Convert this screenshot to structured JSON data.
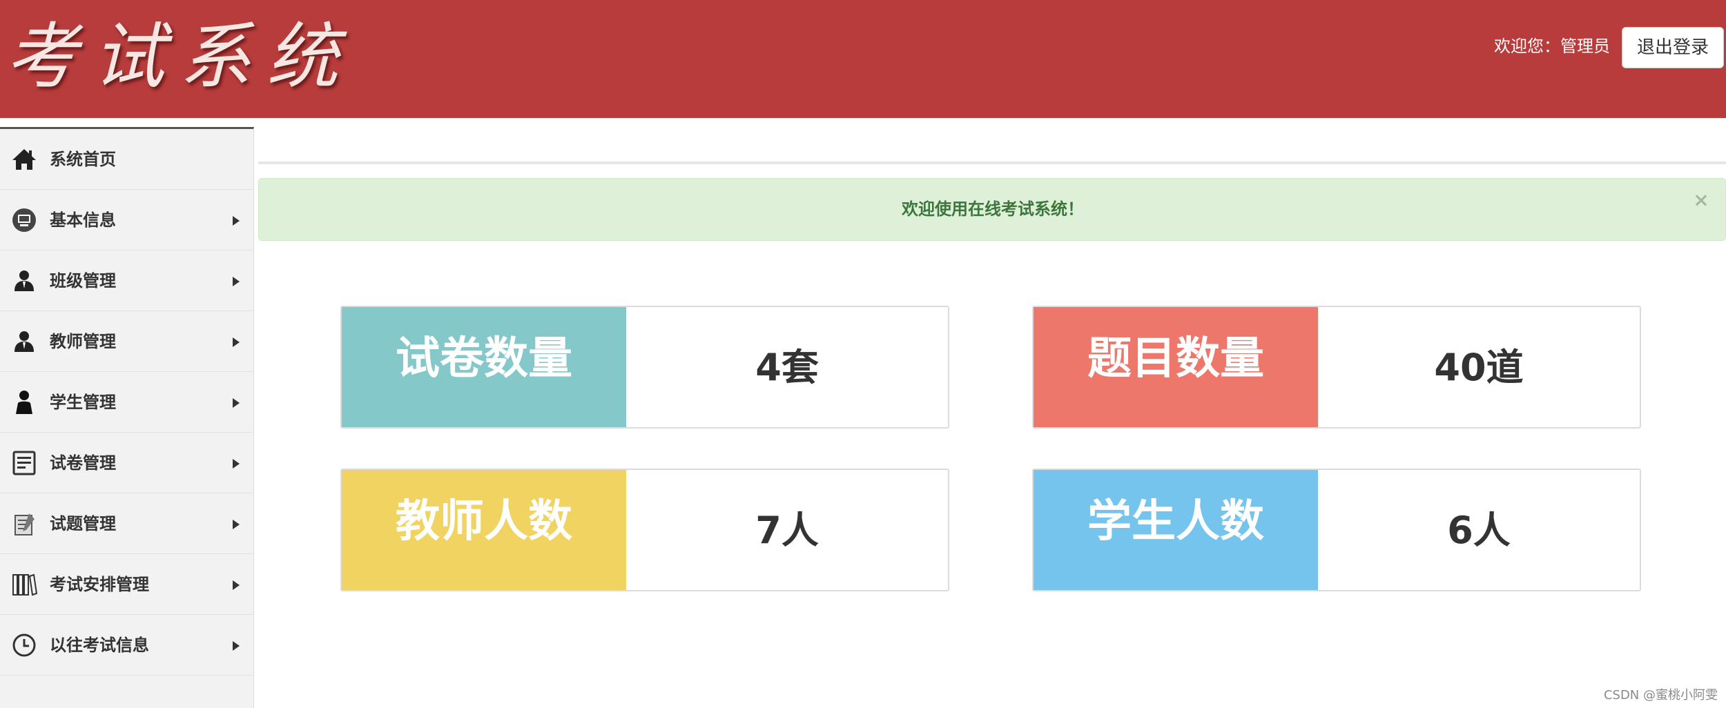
{
  "header": {
    "logo_text": "考试系统",
    "welcome_text": "欢迎您：管理员",
    "logout_label": "退出登录",
    "background_color": "#b73c3b"
  },
  "sidebar": {
    "items": [
      {
        "label": "系统首页",
        "icon": "home-icon",
        "has_submenu": false
      },
      {
        "label": "基本信息",
        "icon": "monitor-icon",
        "has_submenu": true
      },
      {
        "label": "班级管理",
        "icon": "user-icon",
        "has_submenu": true
      },
      {
        "label": "教师管理",
        "icon": "user-icon",
        "has_submenu": true
      },
      {
        "label": "学生管理",
        "icon": "user-icon",
        "has_submenu": true
      },
      {
        "label": "试卷管理",
        "icon": "document-icon",
        "has_submenu": true
      },
      {
        "label": "试题管理",
        "icon": "notepad-icon",
        "has_submenu": true
      },
      {
        "label": "考试安排管理",
        "icon": "books-icon",
        "has_submenu": true
      },
      {
        "label": "以往考试信息",
        "icon": "clock-icon",
        "has_submenu": true
      }
    ]
  },
  "alert": {
    "message": "欢迎使用在线考试系统！",
    "close_symbol": "×",
    "background_color": "#dff0d8",
    "text_color": "#3c763d"
  },
  "stats": [
    {
      "label": "试卷数量",
      "value": "4套",
      "color": "#84c8c9"
    },
    {
      "label": "题目数量",
      "value": "40道",
      "color": "#ee776b"
    },
    {
      "label": "教师人数",
      "value": "7人",
      "color": "#f1d362"
    },
    {
      "label": "学生人数",
      "value": "6人",
      "color": "#74c4ee"
    }
  ],
  "watermark": "CSDN @蜜桃小阿雯"
}
